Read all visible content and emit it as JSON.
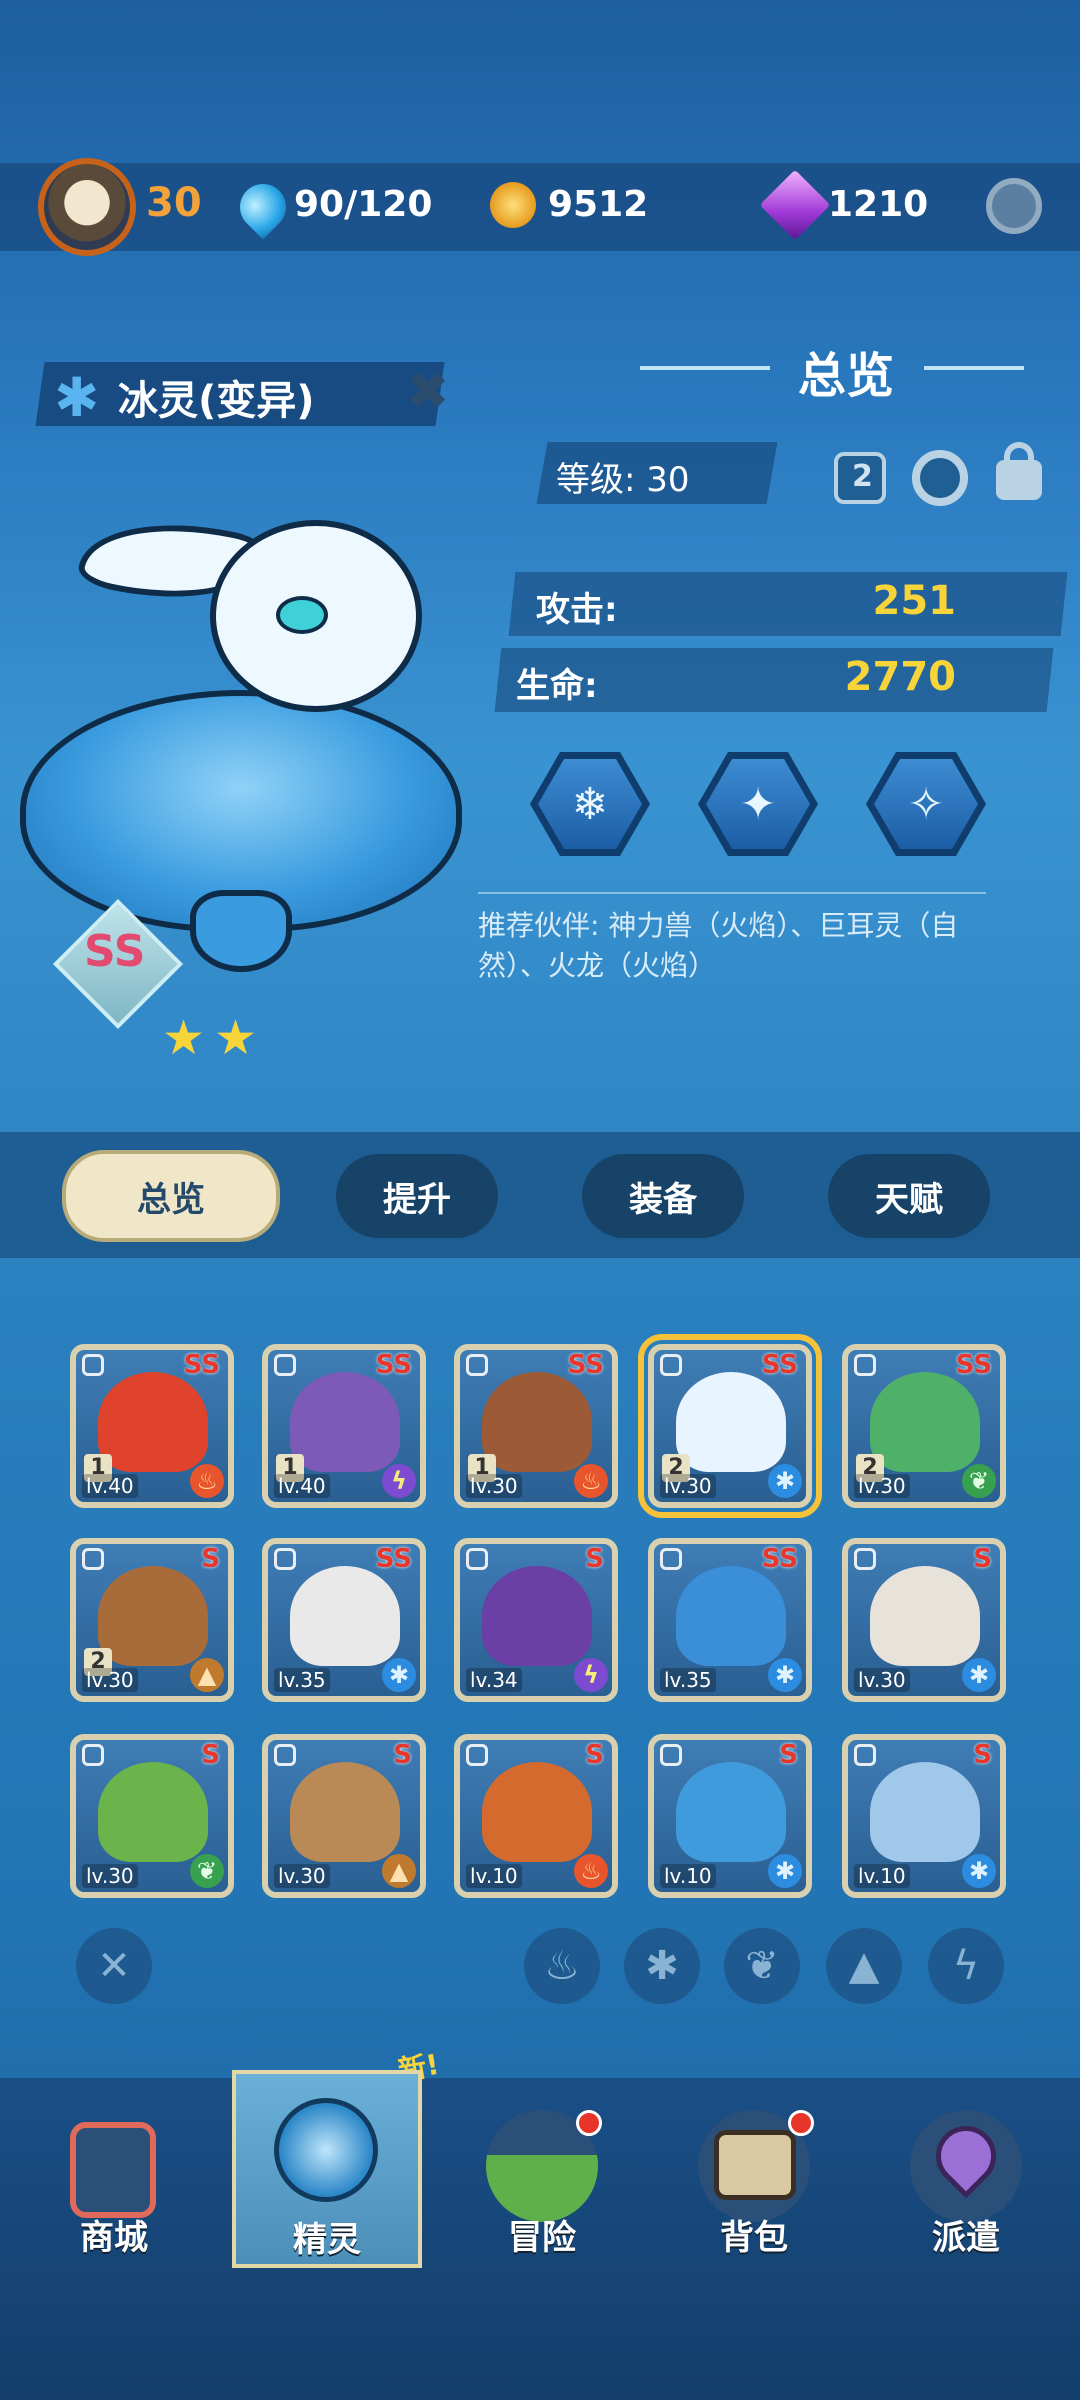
{
  "header": {
    "player_level": "30",
    "energy": "90/120",
    "coins": "9512",
    "gems": "1210"
  },
  "pet": {
    "name": "冰灵(变异)",
    "grade": "SS",
    "stars": 2
  },
  "overview": {
    "title": "总览",
    "level_label": "等级: 30",
    "chip_value": "2",
    "attack_label": "攻击:",
    "attack_value": "251",
    "hp_label": "生命:",
    "hp_value": "2770",
    "partners": "推荐伙伴: 神力兽（火焰）、巨耳灵（自然）、火龙（火焰）"
  },
  "tabs": [
    "总览",
    "提升",
    "装备",
    "天赋"
  ],
  "pets": [
    {
      "grade": "SS",
      "level": "lv.40",
      "star": "1",
      "element": "fire"
    },
    {
      "grade": "SS",
      "level": "lv.40",
      "star": "1",
      "element": "thunder"
    },
    {
      "grade": "SS",
      "level": "lv.30",
      "star": "1",
      "element": "fire"
    },
    {
      "grade": "SS",
      "level": "lv.30",
      "star": "2",
      "element": "ice"
    },
    {
      "grade": "SS",
      "level": "lv.30",
      "star": "2",
      "element": "nature"
    },
    {
      "grade": "S",
      "level": "lv.30",
      "star": "2",
      "element": "earth"
    },
    {
      "grade": "SS",
      "level": "lv.35",
      "star": "",
      "element": "ice"
    },
    {
      "grade": "S",
      "level": "lv.34",
      "star": "",
      "element": "thunder"
    },
    {
      "grade": "SS",
      "level": "lv.35",
      "star": "",
      "element": "ice"
    },
    {
      "grade": "S",
      "level": "lv.30",
      "star": "",
      "element": "ice"
    },
    {
      "grade": "S",
      "level": "lv.30",
      "star": "",
      "element": "nature"
    },
    {
      "grade": "S",
      "level": "lv.30",
      "star": "",
      "element": "earth"
    },
    {
      "grade": "S",
      "level": "lv.10",
      "star": "",
      "element": "fire"
    },
    {
      "grade": "S",
      "level": "lv.10",
      "star": "",
      "element": "ice"
    },
    {
      "grade": "S",
      "level": "lv.10",
      "star": "",
      "element": "ice"
    }
  ],
  "nav": {
    "items": [
      "商城",
      "精灵",
      "冒险",
      "背包",
      "派遣"
    ],
    "new_tag": "新!"
  },
  "colors": {
    "accent_gold": "#f6d43a",
    "level_orange": "#f2a23a",
    "tab_active": "#efe7c8"
  }
}
